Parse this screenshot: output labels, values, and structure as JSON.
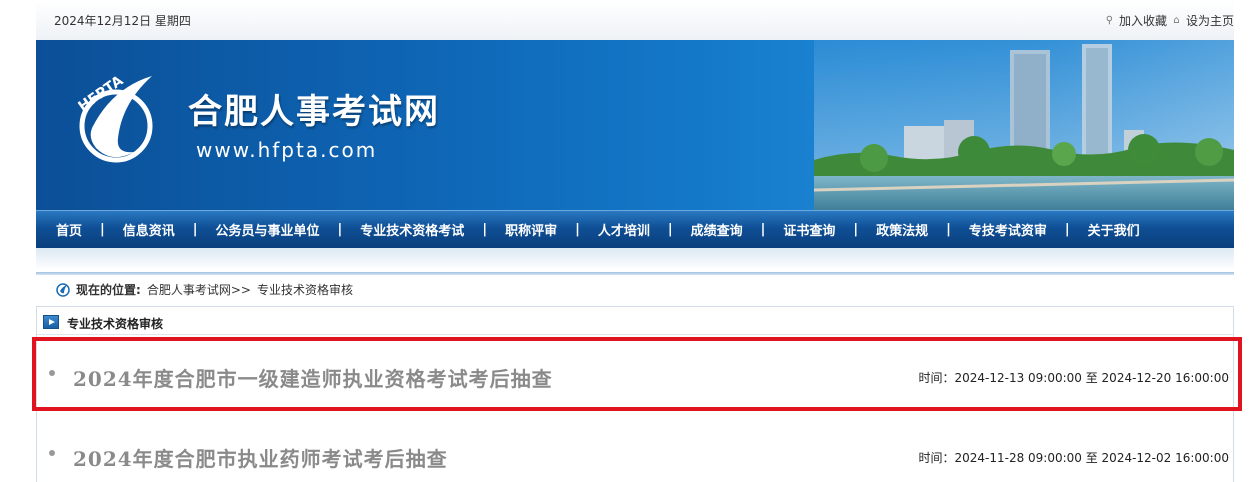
{
  "topbar": {
    "date": "2024年12月12日 星期四",
    "favorite_label": "加入收藏",
    "homepage_label": "设为主页"
  },
  "banner": {
    "logo_text": "HFPTA",
    "site_title": "合肥人事考试网",
    "site_url": "www.hfpta.com"
  },
  "nav": {
    "items": [
      "首页",
      "信息资讯",
      "公务员与事业单位",
      "专业技术资格考试",
      "职称评审",
      "人才培训",
      "成绩查询",
      "证书查询",
      "政策法规",
      "专技考试资审",
      "关于我们"
    ],
    "separator": "|"
  },
  "breadcrumb": {
    "label": "现在的位置:",
    "home": "合肥人事考试网",
    "arrow": ">>",
    "current": "专业技术资格审核"
  },
  "section": {
    "title": "专业技术资格审核",
    "items": [
      {
        "title": "2024年度合肥市一级建造师执业资格考试考后抽查",
        "time": "时间：2024-12-13 09:00:00 至 2024-12-20 16:00:00"
      },
      {
        "title": "2024年度合肥市执业药师考试考后抽查",
        "time": "时间：2024-11-28 09:00:00 至 2024-12-02 16:00:00"
      }
    ]
  },
  "colors": {
    "highlight": "#e0141e",
    "nav_bg": "#0f4f95",
    "banner_bg": "#1478c9"
  }
}
